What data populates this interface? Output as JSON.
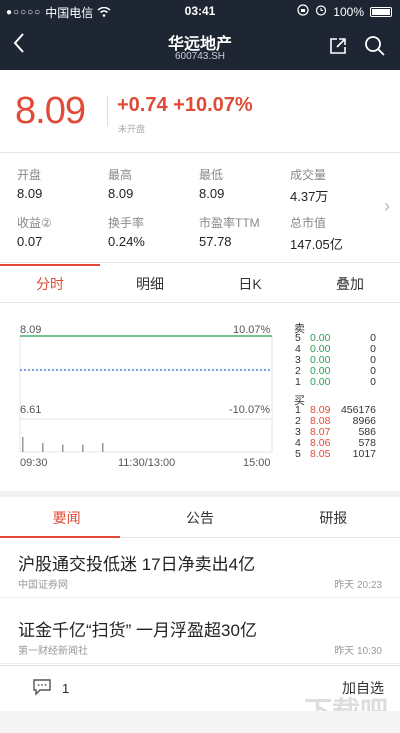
{
  "status_bar": {
    "signal": "●○○○○",
    "carrier": "中国电信",
    "time": "03:41",
    "battery": "100%"
  },
  "nav": {
    "title": "华远地产",
    "code": "600743.SH"
  },
  "quote": {
    "price": "8.09",
    "change": "+0.74 +10.07%",
    "market_status": "未开盘"
  },
  "stats": [
    {
      "label": "开盘",
      "value": "8.09"
    },
    {
      "label": "最高",
      "value": "8.09"
    },
    {
      "label": "最低",
      "value": "8.09"
    },
    {
      "label": "成交量",
      "value": "4.37万"
    },
    {
      "label": "收益②",
      "value": "0.07"
    },
    {
      "label": "换手率",
      "value": "0.24%"
    },
    {
      "label": "市盈率TTM",
      "value": "57.78"
    },
    {
      "label": "总市值",
      "value": "147.05亿"
    }
  ],
  "chart_tabs": [
    "分时",
    "明细",
    "日K",
    "叠加"
  ],
  "chart": {
    "price_high": "8.09",
    "pct_high": "10.07%",
    "price_low": "6.61",
    "pct_low": "-10.07%",
    "time_start": "09:30",
    "time_mid": "11:30/13:00",
    "time_end": "15:00"
  },
  "chart_data": {
    "type": "line",
    "x": [
      "09:30"
    ],
    "series": [
      {
        "values": [
          8.09
        ]
      }
    ],
    "ylim": [
      6.61,
      8.09
    ],
    "volume_bars": [
      0.5,
      0.3,
      0.25,
      0.25,
      0.3
    ]
  },
  "order_book": {
    "sell_label": "卖",
    "buy_label": "买",
    "sell": [
      {
        "level": "5",
        "price": "0.00",
        "volume": "0"
      },
      {
        "level": "4",
        "price": "0.00",
        "volume": "0"
      },
      {
        "level": "3",
        "price": "0.00",
        "volume": "0"
      },
      {
        "level": "2",
        "price": "0.00",
        "volume": "0"
      },
      {
        "level": "1",
        "price": "0.00",
        "volume": "0"
      }
    ],
    "buy": [
      {
        "level": "1",
        "price": "8.09",
        "volume": "456176"
      },
      {
        "level": "2",
        "price": "8.08",
        "volume": "8966"
      },
      {
        "level": "3",
        "price": "8.07",
        "volume": "586"
      },
      {
        "level": "4",
        "price": "8.06",
        "volume": "578"
      },
      {
        "level": "5",
        "price": "8.05",
        "volume": "1017"
      }
    ]
  },
  "news_tabs": [
    "要闻",
    "公告",
    "研报"
  ],
  "news": [
    {
      "headline": "沪股通交投低迷 17日净卖出4亿",
      "source": "中国证券网",
      "time": "昨天 20:23"
    },
    {
      "headline": "证金千亿“扫货” 一月浮盈超30亿",
      "source": "第一财经新闻社",
      "time": "昨天 10:30"
    }
  ],
  "bottom": {
    "comment_count": "1",
    "add_label": "加自选"
  },
  "watermark": "下载吧",
  "colors": {
    "up": "#e04a37",
    "down": "#2a9d57",
    "header": "#1f2633"
  }
}
